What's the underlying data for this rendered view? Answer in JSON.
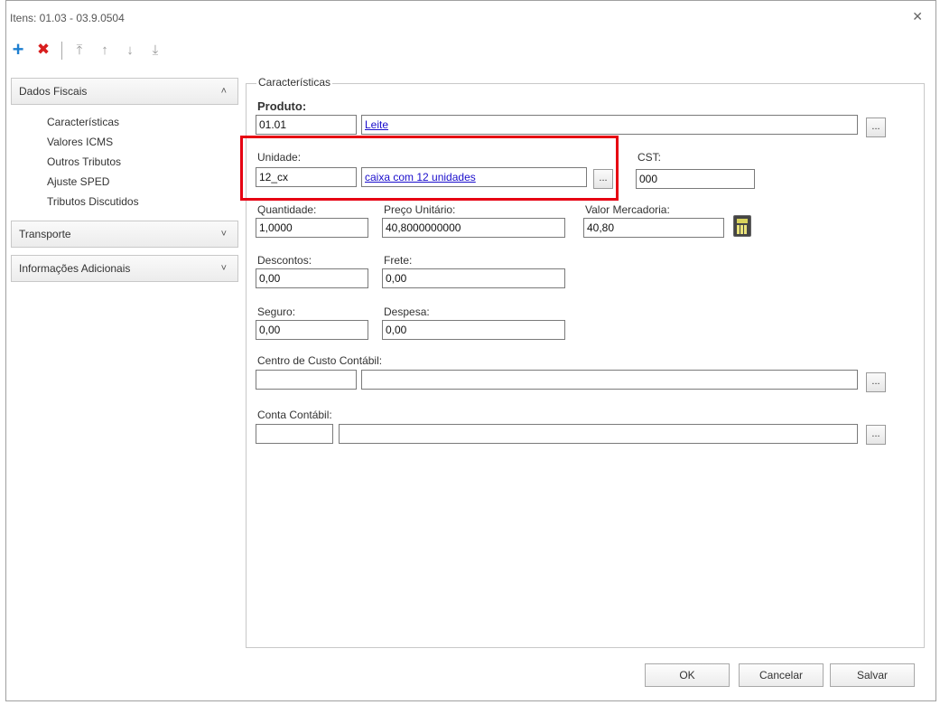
{
  "window": {
    "title": "Itens: 01.03 - 03.9.0504",
    "close_glyph": "✕"
  },
  "toolbar": {
    "add_glyph": "+",
    "delete_glyph": "✖",
    "move_top_glyph": "⤒",
    "move_up_glyph": "↑",
    "move_down_glyph": "↓",
    "move_bottom_glyph": "⤓"
  },
  "sidebar": {
    "dados_fiscais": "Dados Fiscais",
    "items": [
      "Características",
      "Valores ICMS",
      "Outros Tributos",
      "Ajuste SPED",
      "Tributos Discutidos"
    ],
    "transporte": "Transporte",
    "info_adicionais": "Informações Adicionais",
    "chev_up": "˄",
    "chev_down": "˅"
  },
  "form": {
    "legend": "Características",
    "produto_label": "Produto:",
    "produto_code": "01.01",
    "produto_desc": "Leite",
    "unidade_label": "Unidade:",
    "unidade_code": "12_cx",
    "unidade_desc": "caixa com 12 unidades",
    "cst_label": "CST:",
    "cst_value": "000",
    "quantidade_label": "Quantidade:",
    "quantidade_value": "1,0000",
    "preco_label": "Preço Unitário:",
    "preco_value": "40,8000000000",
    "valor_label": "Valor Mercadoria:",
    "valor_value": "40,80",
    "descontos_label": "Descontos:",
    "descontos_value": "0,00",
    "frete_label": "Frete:",
    "frete_value": "0,00",
    "seguro_label": "Seguro:",
    "seguro_value": "0,00",
    "despesa_label": "Despesa:",
    "despesa_value": "0,00",
    "centro_label": "Centro de Custo Contábil:",
    "conta_label": "Conta Contábil:",
    "lookup_glyph": "..."
  },
  "footer": {
    "ok": "OK",
    "cancelar": "Cancelar",
    "salvar": "Salvar"
  },
  "colors": {
    "highlight": "#e60012",
    "add": "#1e7fd0",
    "delete": "#d81e1e",
    "link": "#1a0dcc"
  }
}
